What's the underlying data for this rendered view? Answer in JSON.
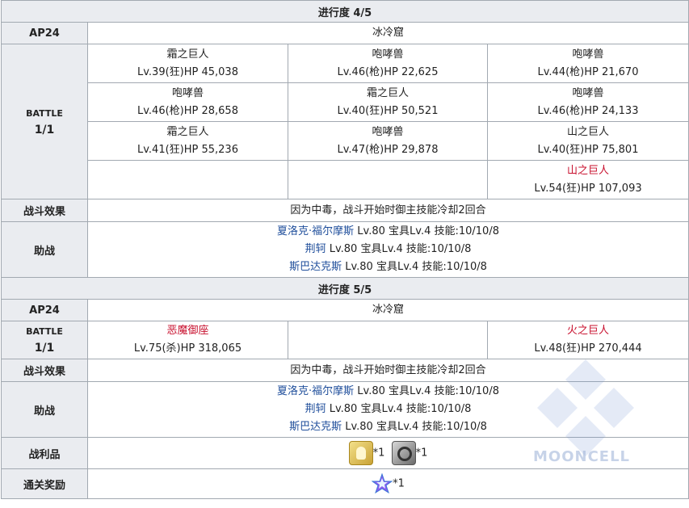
{
  "sections": [
    {
      "progress": "进行度 4/5",
      "ap": "AP24",
      "location": "冰冷窟",
      "battle_label_1": "BATTLE",
      "battle_label_2": "1/1",
      "enemies": [
        [
          {
            "name": "霜之巨人",
            "stats": "Lv.39(狂)HP 45,038"
          },
          {
            "name": "咆哮兽",
            "stats": "Lv.46(枪)HP 22,625"
          },
          {
            "name": "咆哮兽",
            "stats": "Lv.44(枪)HP 21,670"
          }
        ],
        [
          {
            "name": "咆哮兽",
            "stats": "Lv.46(枪)HP 28,658"
          },
          {
            "name": "霜之巨人",
            "stats": "Lv.40(狂)HP 50,521"
          },
          {
            "name": "咆哮兽",
            "stats": "Lv.46(枪)HP 24,133"
          }
        ],
        [
          {
            "name": "霜之巨人",
            "stats": "Lv.41(狂)HP 55,236"
          },
          {
            "name": "咆哮兽",
            "stats": "Lv.47(枪)HP 29,878"
          },
          {
            "name": "山之巨人",
            "stats": "Lv.40(狂)HP 75,801"
          }
        ],
        [
          {
            "name": "",
            "stats": ""
          },
          {
            "name": "",
            "stats": ""
          },
          {
            "name": "山之巨人",
            "stats": "Lv.54(狂)HP 107,093"
          }
        ]
      ],
      "effect_label": "战斗效果",
      "effect": "因为中毒，战斗开始时御主技能冷却2回合",
      "support_label": "助战",
      "supports": [
        {
          "name": "夏洛克·福尔摩斯",
          "detail": " Lv.80 宝具Lv.4 技能:10/10/8"
        },
        {
          "name": "荆轲",
          "detail": " Lv.80 宝具Lv.4 技能:10/10/8"
        },
        {
          "name": "斯巴达克斯",
          "detail": " Lv.80 宝具Lv.4 技能:10/10/8"
        }
      ]
    },
    {
      "progress": "进行度 5/5",
      "ap": "AP24",
      "location": "冰冷窟",
      "battle_label_1": "BATTLE",
      "battle_label_2": "1/1",
      "enemies": [
        [
          {
            "name": "恶魔御座",
            "stats": "Lv.75(杀)HP 318,065"
          },
          {
            "name": "",
            "stats": ""
          },
          {
            "name": "火之巨人",
            "stats": "Lv.48(狂)HP 270,444"
          }
        ]
      ],
      "effect_label": "战斗效果",
      "effect": "因为中毒，战斗开始时御主技能冷却2回合",
      "support_label": "助战",
      "supports": [
        {
          "name": "夏洛克·福尔摩斯",
          "detail": " Lv.80 宝具Lv.4 技能:10/10/8"
        },
        {
          "name": "荆轲",
          "detail": " Lv.80 宝具Lv.4 技能:10/10/8"
        },
        {
          "name": "斯巴达克斯",
          "detail": " Lv.80 宝具Lv.4 技能:10/10/8"
        }
      ]
    }
  ],
  "drops_label": "战利品",
  "drops": [
    {
      "icon": "golden-material-icon",
      "count": "*1"
    },
    {
      "icon": "silver-ring-material-icon",
      "count": "*1"
    }
  ],
  "reward_label": "通关奖励",
  "reward": {
    "icon": "saint-quartz-icon",
    "count": "*1"
  },
  "watermark": "MOONCELL",
  "colors": {
    "header_bg": "#eaecf0",
    "border": "#a2a9b1",
    "boss_name": "#c8102e",
    "link": "#1f4e9b"
  }
}
